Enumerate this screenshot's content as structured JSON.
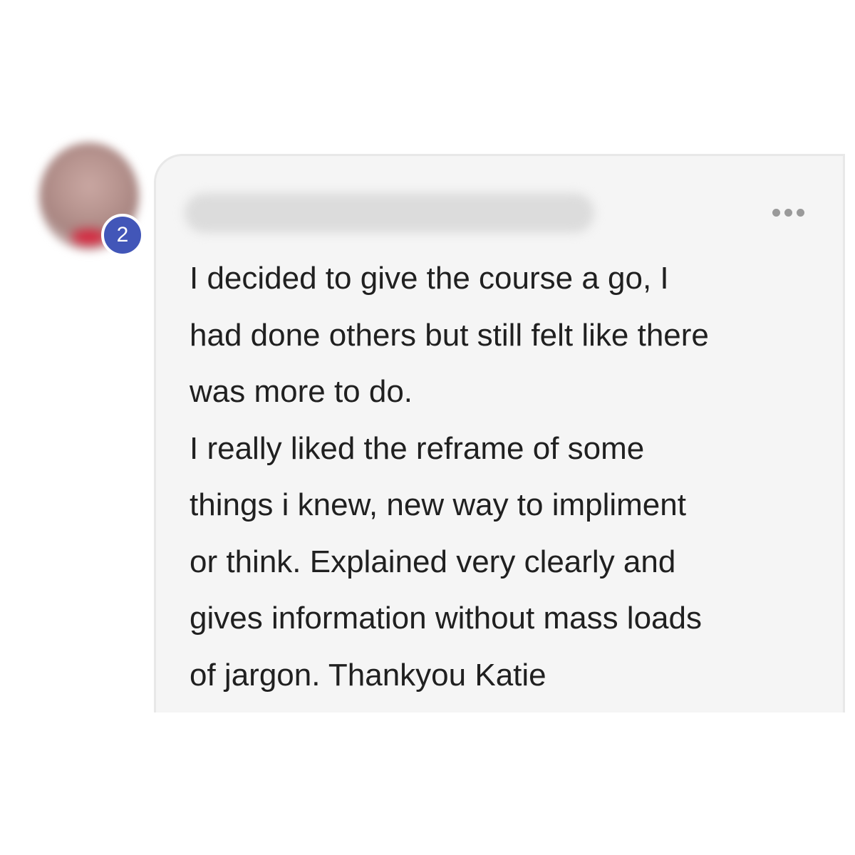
{
  "avatar": {
    "badge_count": "2"
  },
  "comment": {
    "author_name_redacted": true,
    "menu_icon": "more-horizontal-icon",
    "lines": [
      "I decided to give the course a go, I",
      "had done others but still felt like there",
      "was more to do.",
      "I really liked the reframe of some",
      "things i knew, new way to impliment",
      "or think. Explained very clearly and",
      "gives information without mass loads",
      "of jargon. Thankyou Katie"
    ]
  },
  "colors": {
    "badge": "#4256b8",
    "bubble_bg": "#f5f5f5",
    "bubble_border": "#e8e8e8",
    "text": "#202020",
    "menu_dots": "#9a9a9a"
  }
}
